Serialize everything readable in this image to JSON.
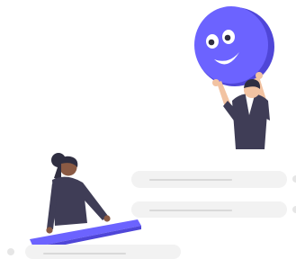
{
  "colors": {
    "accent": "#6c63ff",
    "accent_dark": "#4f46d8",
    "skin_dark": "#8a5a44",
    "skin_light": "#f2c3a2",
    "hair": "#2f2e41",
    "suit": "#3f3d56",
    "shirt": "#ffffff",
    "placeholder_bg": "#f2f2f2",
    "placeholder_line": "#d9d9d9"
  },
  "illustration": {
    "ball_icon": "smiley-face-ball-icon",
    "board_icon": "purple-plank-icon"
  }
}
